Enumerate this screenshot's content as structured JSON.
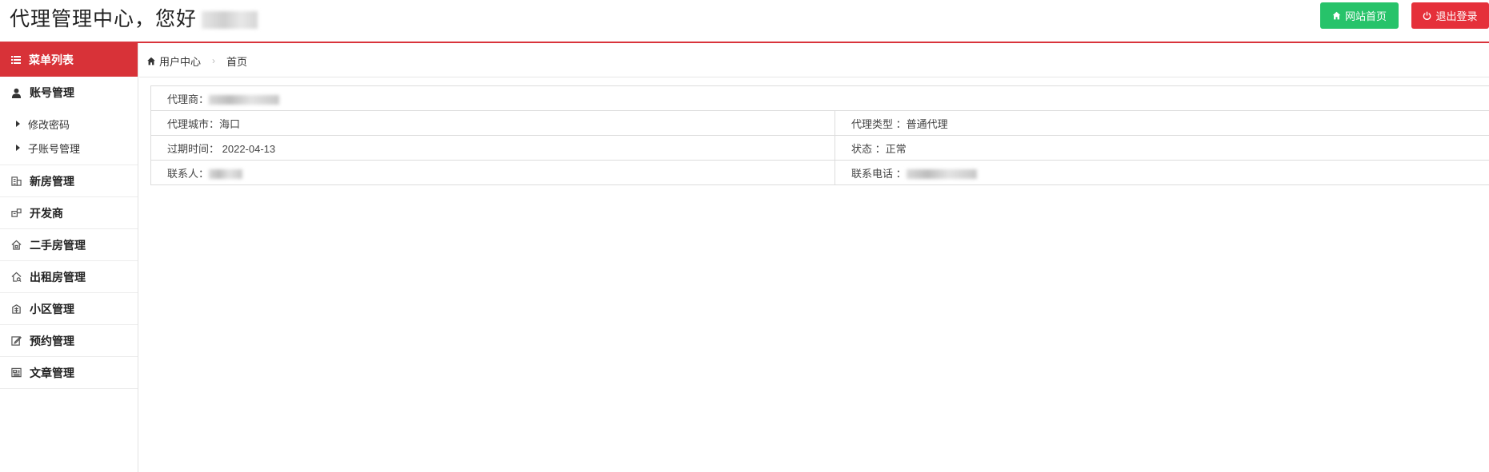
{
  "header": {
    "title": "代理管理中心，您好",
    "home_button": "网站首页",
    "logout_button": "退出登录",
    "colors": {
      "accent": "#d83238",
      "home": "#27c36a",
      "logout": "#e5303a"
    }
  },
  "sidebar": {
    "menu_title": "菜单列表",
    "account": {
      "label": "账号管理",
      "sub": [
        "修改密码",
        "子账号管理"
      ]
    },
    "items": [
      "新房管理",
      "开发商",
      "二手房管理",
      "出租房管理",
      "小区管理",
      "预约管理",
      "文章管理"
    ]
  },
  "breadcrumb": {
    "root": "用户中心",
    "current": "首页"
  },
  "info": {
    "agent_label": "代理商：",
    "city_label": "代理城市：",
    "city_value": "海口",
    "type_label": "代理类型 ：",
    "type_value": "普通代理",
    "expire_label": "过期时间：",
    "expire_value": "2022-04-13",
    "status_label": "状态 ：",
    "status_value": "正常",
    "contact_label": "联系人：",
    "phone_label": "联系电话 ："
  }
}
